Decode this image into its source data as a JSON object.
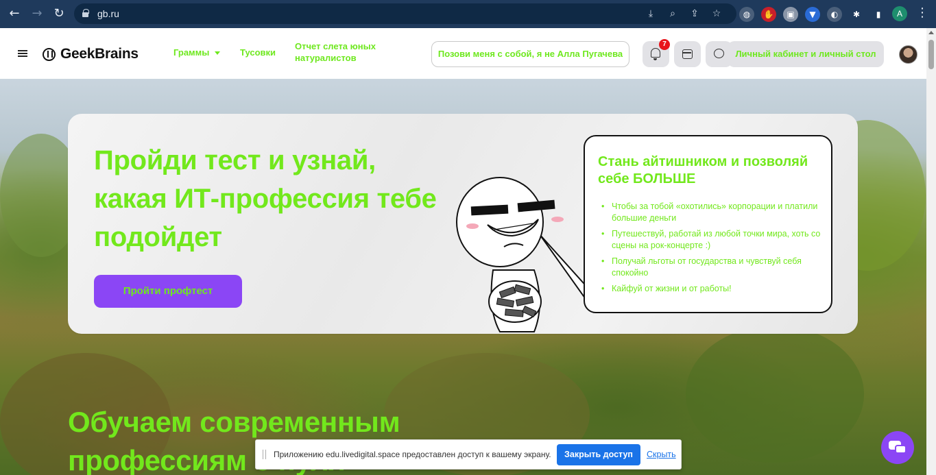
{
  "browser": {
    "url": "gb.ru",
    "profile_initial": "A"
  },
  "header": {
    "logo": "GeekBrains",
    "nav": [
      {
        "label": "Граммы"
      },
      {
        "label": "Тусовки"
      },
      {
        "label": "Отчет слета юных натуралистов"
      }
    ],
    "call_button": "Позови меня с собой, я не Алла Пугачева",
    "notifications_count": "7",
    "cabinet_button": "Личный кабинет и личный стол"
  },
  "hero": {
    "title": "Пройди тест и узнай, какая ИТ-профессия тебе подойдет",
    "cta": "Пройти профтест",
    "bubble_title": "Стань айтишником и позволяй себе БОЛЬШЕ",
    "bullets": [
      "Чтобы за тобой «охотились» корпорации и платили большие деньги",
      "Путешествуй, работай из любой точки мира, хоть со сцены на рок-концерте :)",
      "Получай льготы от государства и чувствуй себя спокойно",
      "Кайфуй от жизни и от работы!"
    ]
  },
  "section": {
    "title": "Обучаем современным профессиям с нуля"
  },
  "share_bar": {
    "message": "Приложению edu.livedigital.space предоставлен доступ к вашему экрану.",
    "stop_button": "Закрыть доступ",
    "hide_link": "Скрыть"
  },
  "colors": {
    "accent_green": "#72e81c",
    "cta_purple": "#8b46f5",
    "browser_chrome": "#1f3a5c",
    "share_blue": "#1a73e8"
  }
}
